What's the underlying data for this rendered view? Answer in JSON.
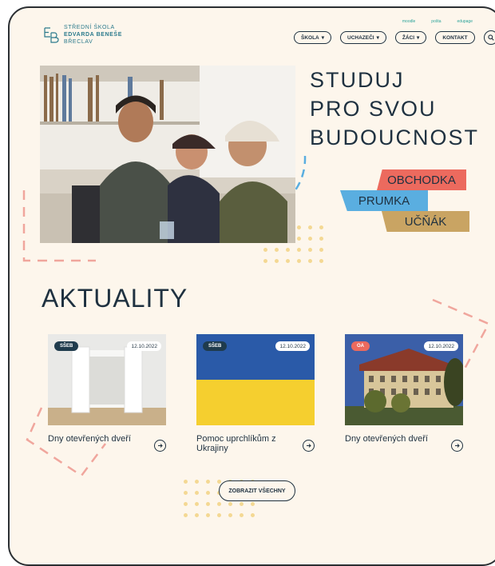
{
  "logo": {
    "line1": "STŘEDNÍ ŠKOLA",
    "line2": "EDVARDA BENEŠE",
    "line3": "BŘECLAV"
  },
  "toplinks": [
    "moodle",
    "pošta",
    "edupage"
  ],
  "nav": {
    "items": [
      {
        "label": "ŠKOLA",
        "dropdown": true
      },
      {
        "label": "UCHAZEČI",
        "dropdown": true
      },
      {
        "label": "ŽÁCI",
        "dropdown": true
      },
      {
        "label": "KONTAKT",
        "dropdown": false
      }
    ]
  },
  "hero": {
    "lines": [
      "STUDUJ",
      "PRO SVOU",
      "BUDOUCNOST"
    ],
    "tags": [
      "OBCHODKA",
      "PRUMKA",
      "UČŇÁK"
    ]
  },
  "news": {
    "title": "AKTUALITY",
    "cards": [
      {
        "badge": "SŠEB",
        "date": "12.10.2022",
        "title": "Dny otevřených dveří",
        "badge_color": "#1f3b4d"
      },
      {
        "badge": "SŠEB",
        "date": "12.10.2022",
        "title": "Pomoc uprchlíkům z Ukrajiny",
        "badge_color": "#1f3b4d"
      },
      {
        "badge": "OA",
        "date": "12.10.2022",
        "title": "Dny otevřených dveří",
        "badge_color": "#ec6a5e"
      }
    ],
    "show_all": "ZOBRAZIT VŠECHNY"
  },
  "colors": {
    "accent_red": "#ec6a5e",
    "accent_blue": "#5aaee0",
    "accent_gold": "#c9a463",
    "dark": "#1f3140"
  }
}
